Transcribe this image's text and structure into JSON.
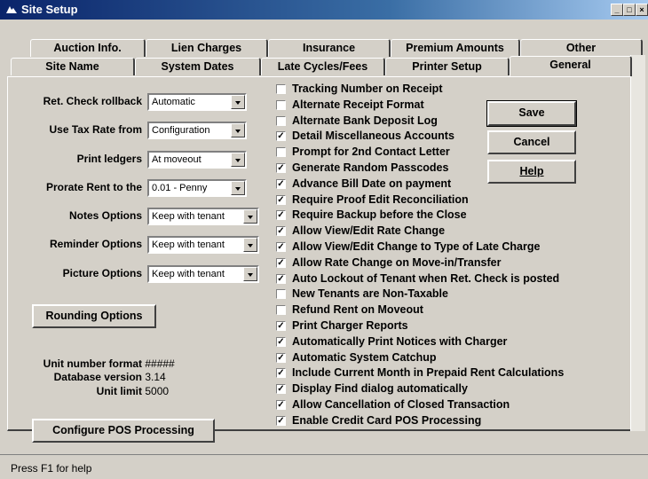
{
  "window": {
    "title": "Site Setup"
  },
  "caption_buttons": [
    "_",
    "□",
    "×"
  ],
  "tabs_back": [
    "Auction Info.",
    "Lien Charges",
    "Insurance",
    "Premium Amounts",
    "Other"
  ],
  "tabs_front": [
    "Site Name",
    "System Dates",
    "Late Cycles/Fees",
    "Printer Setup",
    "General"
  ],
  "active_tab": "General",
  "fields": [
    {
      "label": "Ret. Check rollback",
      "value": "Automatic"
    },
    {
      "label": "Use Tax Rate from",
      "value": "Configuration"
    },
    {
      "label": "Print ledgers",
      "value": "At moveout"
    },
    {
      "label": "Prorate Rent to the",
      "value": "0.01 - Penny"
    },
    {
      "label": "Notes Options",
      "value": "Keep with tenant"
    },
    {
      "label": "Reminder Options",
      "value": "Keep with tenant"
    },
    {
      "label": "Picture Options",
      "value": "Keep with tenant"
    }
  ],
  "buttons": {
    "rounding": "Rounding Options",
    "configure_pos": "Configure POS Processing",
    "save": "Save",
    "cancel": "Cancel",
    "help": "Help"
  },
  "info": {
    "unit_format_label": "Unit number format",
    "unit_format_value": "#####",
    "db_version_label": "Database version",
    "db_version_value": "3.14",
    "unit_limit_label": "Unit limit",
    "unit_limit_value": "5000"
  },
  "checkboxes": [
    {
      "label": "Tracking Number on Receipt",
      "checked": false
    },
    {
      "label": "Alternate Receipt Format",
      "checked": false
    },
    {
      "label": "Alternate Bank Deposit Log",
      "checked": false
    },
    {
      "label": "Detail Miscellaneous Accounts",
      "checked": true
    },
    {
      "label": "Prompt for 2nd Contact Letter",
      "checked": false
    },
    {
      "label": "Generate Random Passcodes",
      "checked": true
    },
    {
      "label": "Advance Bill Date on payment",
      "checked": true
    },
    {
      "label": "Require Proof Edit Reconciliation",
      "checked": true
    },
    {
      "label": "Require Backup before the Close",
      "checked": true
    },
    {
      "label": "Allow View/Edit Rate Change",
      "checked": true
    },
    {
      "label": "Allow View/Edit Change to Type of Late Charge",
      "checked": true
    },
    {
      "label": "Allow Rate Change on Move-in/Transfer",
      "checked": true
    },
    {
      "label": "Auto Lockout of Tenant when Ret. Check is posted",
      "checked": true
    },
    {
      "label": "New Tenants are Non-Taxable",
      "checked": false
    },
    {
      "label": "Refund Rent on Moveout",
      "checked": false
    },
    {
      "label": "Print Charger Reports",
      "checked": true
    },
    {
      "label": "Automatically Print Notices with Charger",
      "checked": true
    },
    {
      "label": "Automatic System Catchup",
      "checked": true
    },
    {
      "label": "Include Current Month in Prepaid Rent Calculations",
      "checked": true
    },
    {
      "label": "Display Find dialog automatically",
      "checked": true
    },
    {
      "label": "Allow Cancellation of Closed Transaction",
      "checked": true
    },
    {
      "label": "Enable Credit Card POS Processing",
      "checked": true
    }
  ],
  "status_bar": "Press F1 for help"
}
